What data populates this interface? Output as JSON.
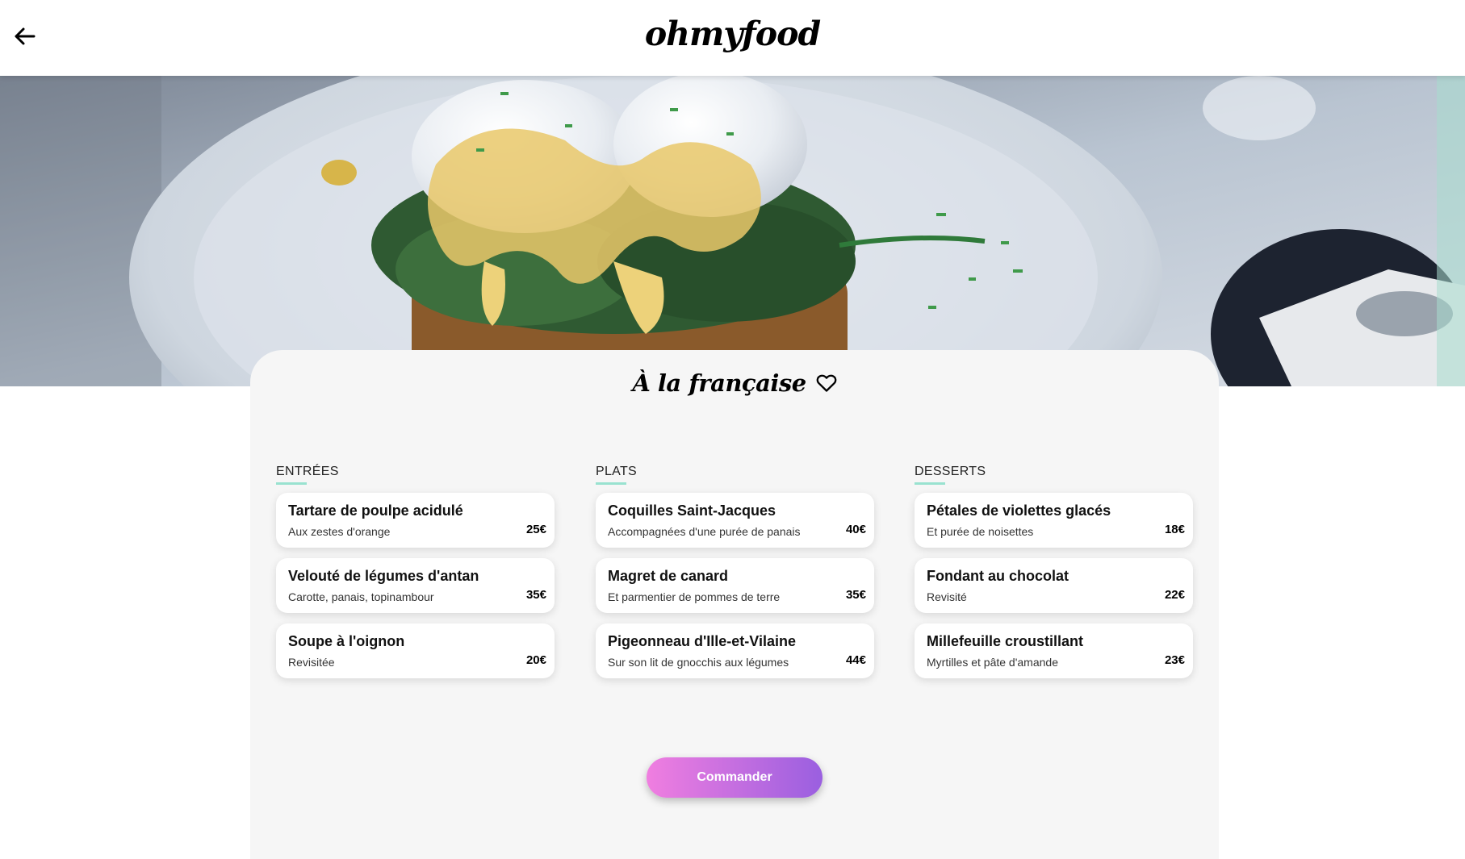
{
  "header": {
    "logo": "ohmyfood"
  },
  "restaurant": {
    "title": "À la française"
  },
  "menu": {
    "columns": [
      {
        "heading": "ENTRÉES",
        "items": [
          {
            "name": "Tartare de poulpe acidulé",
            "description": "Aux zestes d'orange",
            "price": "25€"
          },
          {
            "name": "Velouté de légumes d'antan",
            "description": "Carotte, panais, topinambour",
            "price": "35€"
          },
          {
            "name": "Soupe à l'oignon",
            "description": "Revisitée",
            "price": "20€"
          }
        ]
      },
      {
        "heading": "PLATS",
        "items": [
          {
            "name": "Coquilles Saint-Jacques",
            "description": "Accompagnées d'une purée de panais",
            "price": "40€"
          },
          {
            "name": "Magret de canard",
            "description": "Et parmentier de pommes de terre",
            "price": "35€"
          },
          {
            "name": "Pigeonneau d'Ille-et-Vilaine",
            "description": "Sur son lit de gnocchis aux légumes",
            "price": "44€"
          }
        ]
      },
      {
        "heading": "DESSERTS",
        "items": [
          {
            "name": "Pétales de violettes glacés",
            "description": "Et purée de noisettes",
            "price": "18€"
          },
          {
            "name": "Fondant au chocolat",
            "description": "Revisité",
            "price": "22€"
          },
          {
            "name": "Millefeuille croustillant",
            "description": "Myrtilles et pâte d'amande",
            "price": "23€"
          }
        ]
      }
    ]
  },
  "order_button": {
    "label": "Commander"
  },
  "colors": {
    "accent_underline": "#99e2d0",
    "button_gradient_start": "#f07ee0",
    "button_gradient_end": "#9a5fe0",
    "card_background": "#f6f6f6"
  },
  "icons": {
    "back": "arrow-left-icon",
    "favorite": "heart-outline-icon"
  }
}
